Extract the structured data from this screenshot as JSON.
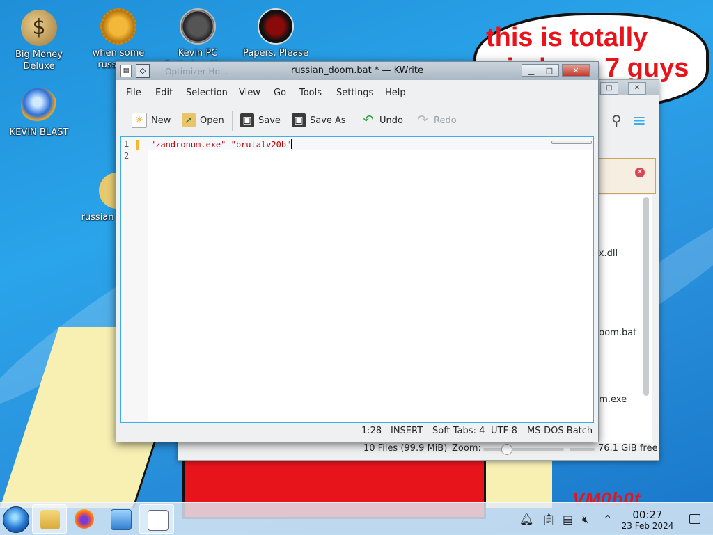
{
  "desktop": {
    "icons": [
      {
        "label": "Big Money Deluxe"
      },
      {
        "label": "when some russian..."
      },
      {
        "label": "Kevin PC Optimizer Ho..."
      },
      {
        "label": "Papers, Please"
      },
      {
        "label": "KEVIN BLAST"
      },
      {
        "label": "russian"
      }
    ],
    "bubble_text": "this is totally windows 7 guys",
    "watermark": "VM0b0t"
  },
  "file_manager": {
    "files": [
      {
        "name": "ex.dll"
      },
      {
        "name": "doom.bat"
      },
      {
        "name": "um.exe"
      }
    ],
    "status": {
      "summary": "10 Files (99.9 MiB)",
      "zoom_label": "Zoom:",
      "free": "76.1 GiB free"
    }
  },
  "kwrite": {
    "title": "russian_doom.bat * — KWrite",
    "ghost_title": "Optimizer Ho...",
    "window_buttons": {
      "minimize": "▁",
      "maximize": "□",
      "close": "✕"
    },
    "menu": [
      "File",
      "Edit",
      "Selection",
      "View",
      "Go",
      "Tools",
      "Settings",
      "Help"
    ],
    "toolbar": {
      "new": "New",
      "open": "Open",
      "save": "Save",
      "save_as": "Save As",
      "undo": "Undo",
      "redo": "Redo"
    },
    "editor": {
      "line_numbers": [
        "1",
        "2"
      ],
      "line1": "\"zandronum.exe\" \"brutalv20b\""
    },
    "status": {
      "position": "1:28",
      "mode": "INSERT",
      "tabs": "Soft Tabs: 4",
      "encoding": "UTF-8",
      "syntax": "MS-DOS Batch"
    }
  },
  "taskbar": {
    "clock_time": "00:27",
    "clock_date": "23 Feb 2024"
  }
}
